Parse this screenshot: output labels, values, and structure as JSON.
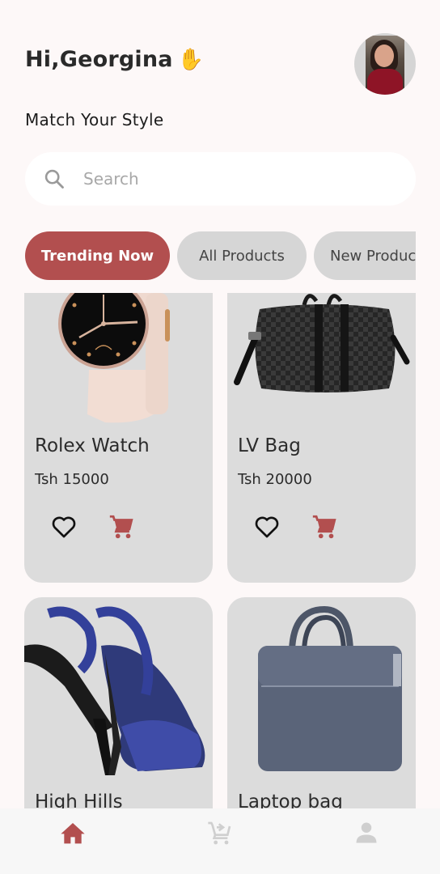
{
  "header": {
    "greeting": "Hi,Georgina",
    "wave_emoji": "✋",
    "subtitle": "Match Your Style",
    "avatar_icon": "user-avatar-photo"
  },
  "search": {
    "placeholder": "Search",
    "value": "",
    "icon": "search-icon"
  },
  "categories": [
    {
      "label": "Trending Now",
      "active": true
    },
    {
      "label": "All Products",
      "active": false
    },
    {
      "label": "New Products",
      "active": false
    }
  ],
  "products": [
    {
      "name": "Rolex Watch",
      "price": "Tsh 15000",
      "image": "watch-image",
      "favorite": false
    },
    {
      "name": "LV Bag",
      "price": "Tsh 20000",
      "image": "duffel-bag-image",
      "favorite": false
    },
    {
      "name": "High Hills",
      "price": "",
      "image": "high-heel-shoes-image",
      "favorite": false
    },
    {
      "name": "Laptop bag",
      "price": "",
      "image": "laptop-bag-image",
      "favorite": false
    }
  ],
  "bottom_nav": [
    {
      "name": "home",
      "icon": "home-icon",
      "active": true
    },
    {
      "name": "cart",
      "icon": "add-to-cart-icon",
      "active": false
    },
    {
      "name": "profile",
      "icon": "person-icon",
      "active": false
    }
  ],
  "colors": {
    "accent": "#b24f4f",
    "background": "#fdf8f8",
    "card": "#dcdcdc",
    "chip_inactive": "#d6d6d6",
    "nav_inactive": "#cfcfcf"
  }
}
